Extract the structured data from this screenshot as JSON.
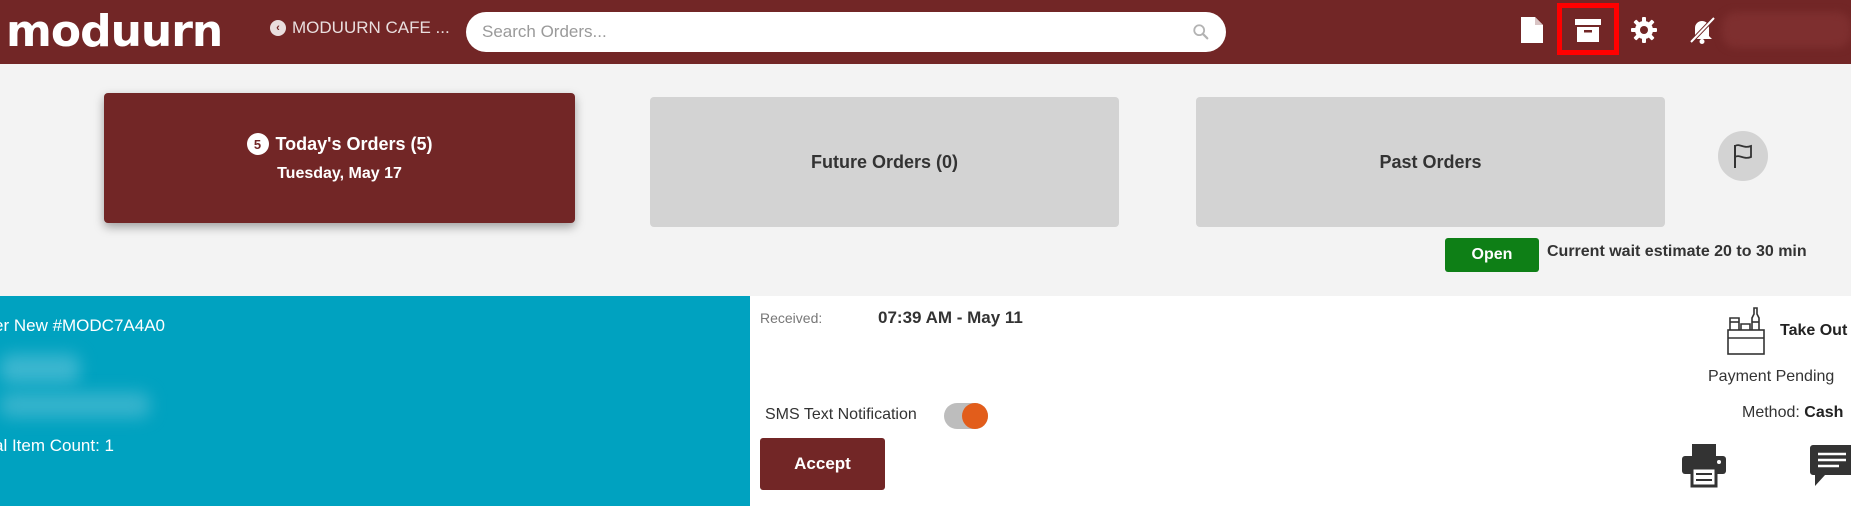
{
  "header": {
    "logo_text": "moduurn",
    "store_selector": "MODUURN CAFE ...",
    "search_placeholder": "Search Orders...",
    "icons": [
      "document-icon",
      "archive-icon",
      "gear-icon",
      "bell-off-icon"
    ],
    "highlight_color": "#ff0000"
  },
  "tabs": {
    "today": {
      "badge": "5",
      "label": "Today's Orders (5)",
      "date": "Tuesday, May 17"
    },
    "future": {
      "label": "Future Orders (0)"
    },
    "past": {
      "label": "Past Orders"
    }
  },
  "status": {
    "open_label": "Open",
    "wait_text": "Current wait estimate 20 to 30 min"
  },
  "order": {
    "title": "er New #MODC7A4A0",
    "item_count": "al Item Count: 1",
    "received_label": "Received:",
    "received_value": "07:39 AM - May 11",
    "sms_label": "SMS Text Notification",
    "sms_enabled": true,
    "accept_label": "Accept",
    "order_type": "Take Out",
    "payment_status": "Payment Pending",
    "method_label": "Method: ",
    "method_value": "Cash"
  },
  "colors": {
    "brand": "#722626",
    "card_accent": "#00a2c0",
    "open_green": "#0e7f16",
    "toggle_knob": "#e25d1b",
    "inactive_tab": "#d3d3d3"
  }
}
